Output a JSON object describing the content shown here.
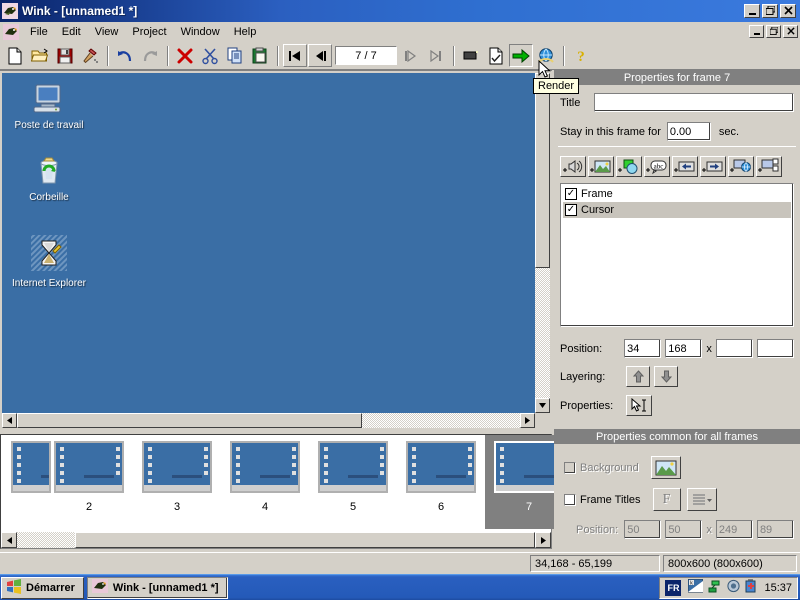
{
  "window": {
    "title": "Wink - [unnamed1 *]",
    "app_icon": "wink-bird-icon",
    "minimize_label": "–",
    "maximize_label": "❐",
    "close_label": "×",
    "mdi_minimize_label": "–",
    "mdi_restore_label": "❐",
    "mdi_close_label": "×"
  },
  "menu": {
    "items": [
      {
        "label": "File",
        "name": "menu-file"
      },
      {
        "label": "Edit",
        "name": "menu-edit"
      },
      {
        "label": "View",
        "name": "menu-view"
      },
      {
        "label": "Project",
        "name": "menu-project"
      },
      {
        "label": "Window",
        "name": "menu-window"
      },
      {
        "label": "Help",
        "name": "menu-help"
      }
    ]
  },
  "toolbar": {
    "frame_counter": "7 / 7",
    "tooltip": "Render",
    "buttons": [
      {
        "name": "new-button",
        "icon": "new-document-icon"
      },
      {
        "name": "open-button",
        "icon": "open-folder-icon"
      },
      {
        "name": "save-button",
        "icon": "floppy-save-icon"
      },
      {
        "name": "build-button",
        "icon": "hammer-icon"
      },
      {
        "name": "undo-button",
        "icon": "undo-arrow-icon"
      },
      {
        "name": "redo-button",
        "icon": "redo-arrow-icon"
      },
      {
        "name": "delete-button",
        "icon": "red-x-icon"
      },
      {
        "name": "cut-button",
        "icon": "scissors-icon"
      },
      {
        "name": "copy-button",
        "icon": "copy-pages-icon"
      },
      {
        "name": "paste-button",
        "icon": "clipboard-paste-icon"
      },
      {
        "name": "first-frame-button",
        "icon": "skip-to-start-icon"
      },
      {
        "name": "previous-frame-button",
        "icon": "step-back-icon"
      },
      {
        "name": "next-frame-button",
        "icon": "step-forward-icon"
      },
      {
        "name": "last-frame-button",
        "icon": "skip-to-end-icon"
      },
      {
        "name": "presentation-button",
        "icon": "screen-icon"
      },
      {
        "name": "properties-button",
        "icon": "document-check-icon"
      },
      {
        "name": "render-button",
        "icon": "green-right-arrow-icon"
      },
      {
        "name": "preview-browser-button",
        "icon": "globe-browser-icon"
      },
      {
        "name": "help-button",
        "icon": "yellow-question-icon"
      }
    ]
  },
  "editor": {
    "desktop_icons": [
      {
        "label": "Poste de travail",
        "name": "desktop-icon-my-computer"
      },
      {
        "label": "Corbeille",
        "name": "desktop-icon-recycle-bin"
      },
      {
        "label": "Internet Explorer",
        "name": "desktop-icon-internet-explorer"
      }
    ]
  },
  "filmstrip": {
    "frames": [
      {
        "label": "",
        "selected": false
      },
      {
        "label": "2",
        "selected": false
      },
      {
        "label": "3",
        "selected": false
      },
      {
        "label": "4",
        "selected": false
      },
      {
        "label": "5",
        "selected": false
      },
      {
        "label": "6",
        "selected": false
      },
      {
        "label": "7",
        "selected": true
      }
    ]
  },
  "frame_properties": {
    "caption": "Properties for frame 7",
    "title_label": "Title",
    "title_value": "",
    "title_placeholder": "",
    "stay_label": "Stay in this frame for",
    "stay_value": "0.00",
    "stay_unit": "sec.",
    "add_buttons": [
      {
        "name": "add-sound-button",
        "icon": "add-speaker-icon"
      },
      {
        "name": "add-image-button",
        "icon": "add-image-icon"
      },
      {
        "name": "add-shape-button",
        "icon": "add-shape-icon"
      },
      {
        "name": "add-text-button",
        "icon": "add-text-abc-icon"
      },
      {
        "name": "add-previous-button",
        "icon": "add-left-arrow-button-icon"
      },
      {
        "name": "add-next-button",
        "icon": "add-right-arrow-button-icon"
      },
      {
        "name": "add-url-button",
        "icon": "add-browser-link-icon"
      },
      {
        "name": "add-navigation-button",
        "icon": "add-navigation-bar-icon"
      }
    ],
    "layers": [
      {
        "label": "Frame",
        "checked": true,
        "selected": false
      },
      {
        "label": "Cursor",
        "checked": true,
        "selected": true
      }
    ],
    "position_label": "Position:",
    "position_x": "34",
    "position_y": "168",
    "position_sep": "x",
    "position_w": "",
    "position_h": "",
    "layering_label": "Layering:",
    "layer_up_icon": "up-arrow-icon",
    "layer_down_icon": "down-arrow-icon",
    "properties_label": "Properties:",
    "properties_icon": "cursor-text-properties-icon"
  },
  "common_properties": {
    "caption": "Properties common for all frames",
    "background_label": "Background",
    "background_checked": false,
    "background_icon": "image-picture-icon",
    "frame_titles_label": "Frame Titles",
    "frame_titles_checked": false,
    "font_button_label": "F",
    "align_icon": "text-align-icon",
    "position_label": "Position:",
    "position_x": "50",
    "position_y": "50",
    "position_sep": "x",
    "position_w": "249",
    "position_h": "89"
  },
  "statusbar": {
    "coordinates": "34,168 - 65,199",
    "dimensions": "800x600 (800x600)"
  },
  "taskbar": {
    "start_label": "Démarrer",
    "start_icon": "windows-flag-icon",
    "tasks": [
      {
        "label": "Wink - [unnamed1 *]",
        "icon": "wink-bird-icon",
        "name": "taskbar-item-wink"
      }
    ],
    "tray": {
      "language": "FR",
      "icons": [
        {
          "name": "tray-display-icon"
        },
        {
          "name": "tray-network-icon"
        },
        {
          "name": "tray-volume-icon"
        },
        {
          "name": "tray-battery-icon"
        }
      ],
      "clock": "15:37"
    }
  },
  "colors": {
    "desktop_blue": "#3a6ea5",
    "chrome_gray": "#d4d0c8",
    "title_blue": "#0a246a",
    "caption_gray": "#808080",
    "accent_green": "#00a000"
  }
}
